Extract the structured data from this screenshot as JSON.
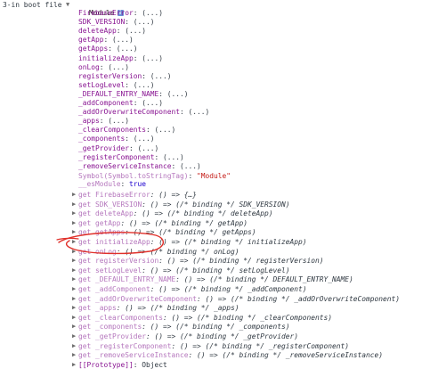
{
  "header": {
    "prefix": "3-in boot file",
    "module_label": "Module",
    "info_icon": "i"
  },
  "properties": [
    {
      "key": "FirebaseError",
      "value": ": (...)"
    },
    {
      "key": "SDK_VERSION",
      "value": ": (...)"
    },
    {
      "key": "deleteApp",
      "value": ": (...)"
    },
    {
      "key": "getApp",
      "value": ": (...)"
    },
    {
      "key": "getApps",
      "value": ": (...)"
    },
    {
      "key": "initializeApp",
      "value": ": (...)"
    },
    {
      "key": "onLog",
      "value": ": (...)"
    },
    {
      "key": "registerVersion",
      "value": ": (...)"
    },
    {
      "key": "setLogLevel",
      "value": ": (...)"
    },
    {
      "key": "_DEFAULT_ENTRY_NAME",
      "value": ": (...)"
    },
    {
      "key": "_addComponent",
      "value": ": (...)"
    },
    {
      "key": "_addOrOverwriteComponent",
      "value": ": (...)"
    },
    {
      "key": "_apps",
      "value": ": (...)"
    },
    {
      "key": "_clearComponents",
      "value": ": (...)"
    },
    {
      "key": "_components",
      "value": ": (...)"
    },
    {
      "key": "_getProvider",
      "value": ": (...)"
    },
    {
      "key": "_registerComponent",
      "value": ": (...)"
    },
    {
      "key": "_removeServiceInstance",
      "value": ": (...)"
    }
  ],
  "symbol_line": {
    "key": "Symbol(Symbol.toStringTag)",
    "sep": ": ",
    "value": "\"Module\""
  },
  "esmodule_line": {
    "key": "__esModule",
    "sep": ": ",
    "value": "true"
  },
  "getters": [
    {
      "prefix": "get ",
      "name": "FirebaseError",
      "value": ": () => {…}"
    },
    {
      "prefix": "get ",
      "name": "SDK_VERSION",
      "value": ": () => (/* binding */ SDK_VERSION)"
    },
    {
      "prefix": "get ",
      "name": "deleteApp",
      "value": ": () => (/* binding */ deleteApp)"
    },
    {
      "prefix": "get ",
      "name": "getApp",
      "value": ": () => (/* binding */ getApp)"
    },
    {
      "prefix": "get ",
      "name": "getApps",
      "value": ": () => (/* binding */ getApps)"
    },
    {
      "prefix": "get ",
      "name": "initializeApp",
      "value": ": () => (/* binding */ initializeApp)"
    },
    {
      "prefix": "get ",
      "name": "onLog",
      "value": ": () => (/* binding */ onLog)"
    },
    {
      "prefix": "get ",
      "name": "registerVersion",
      "value": ": () => (/* binding */ registerVersion)"
    },
    {
      "prefix": "get ",
      "name": "setLogLevel",
      "value": ": () => (/* binding */ setLogLevel)"
    },
    {
      "prefix": "get ",
      "name": "_DEFAULT_ENTRY_NAME",
      "value": ": () => (/* binding */ DEFAULT_ENTRY_NAME)"
    },
    {
      "prefix": "get ",
      "name": "_addComponent",
      "value": ": () => (/* binding */ _addComponent)"
    },
    {
      "prefix": "get ",
      "name": "_addOrOverwriteComponent",
      "value": ": () => (/* binding */ _addOrOverwriteComponent)"
    },
    {
      "prefix": "get ",
      "name": "_apps",
      "value": ": () => (/* binding */ _apps)"
    },
    {
      "prefix": "get ",
      "name": "_clearComponents",
      "value": ": () => (/* binding */ _clearComponents)"
    },
    {
      "prefix": "get ",
      "name": "_components",
      "value": ": () => (/* binding */ _components)"
    },
    {
      "prefix": "get ",
      "name": "_getProvider",
      "value": ": () => (/* binding */ _getProvider)"
    },
    {
      "prefix": "get ",
      "name": "_registerComponent",
      "value": ": () => (/* binding */ _registerComponent)"
    },
    {
      "prefix": "get ",
      "name": "_removeServiceInstance",
      "value": ": () => (/* binding */ _removeServiceInstance)"
    }
  ],
  "prototype_line": {
    "key": "[[Prototype]]",
    "sep": ": ",
    "value": "Object"
  },
  "icons": {
    "expanded": "expanded-triangle-icon",
    "collapsed": "collapsed-triangle-icon",
    "info": "info-icon"
  },
  "colors": {
    "annotation": "#e0302a",
    "property_key": "#881391",
    "string": "#c41a16",
    "boolean": "#1c00cf"
  }
}
